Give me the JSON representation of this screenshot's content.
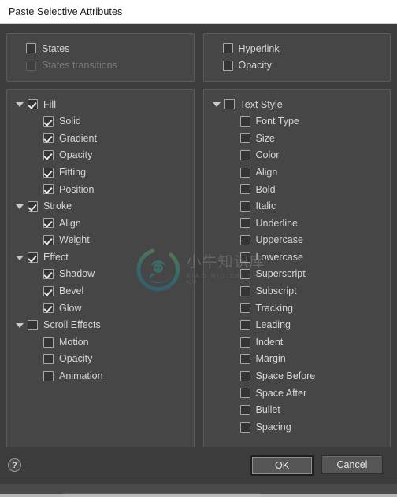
{
  "window": {
    "title": "Paste Selective Attributes"
  },
  "panels": {
    "left_top": {
      "name": "states-panel",
      "items": [
        {
          "label": "States",
          "checked": false,
          "disabled": false,
          "level": "plain"
        },
        {
          "label": "States transitions",
          "checked": false,
          "disabled": true,
          "level": "plain"
        }
      ]
    },
    "right_top": {
      "name": "hyperlink-panel",
      "items": [
        {
          "label": "Hyperlink",
          "checked": false,
          "disabled": false,
          "level": "plain"
        },
        {
          "label": "Opacity",
          "checked": false,
          "disabled": false,
          "level": "plain"
        }
      ]
    },
    "left_main": {
      "name": "graphic-attributes-panel",
      "items": [
        {
          "label": "Fill",
          "checked": true,
          "disabled": false,
          "level": "group",
          "expanded": true
        },
        {
          "label": "Solid",
          "checked": true,
          "disabled": false,
          "level": "child"
        },
        {
          "label": "Gradient",
          "checked": true,
          "disabled": false,
          "level": "child"
        },
        {
          "label": "Opacity",
          "checked": true,
          "disabled": false,
          "level": "child"
        },
        {
          "label": "Fitting",
          "checked": true,
          "disabled": false,
          "level": "child"
        },
        {
          "label": "Position",
          "checked": true,
          "disabled": false,
          "level": "child"
        },
        {
          "label": "Stroke",
          "checked": true,
          "disabled": false,
          "level": "group",
          "expanded": true
        },
        {
          "label": "Align",
          "checked": true,
          "disabled": false,
          "level": "child"
        },
        {
          "label": "Weight",
          "checked": true,
          "disabled": false,
          "level": "child"
        },
        {
          "label": "Effect",
          "checked": true,
          "disabled": false,
          "level": "group",
          "expanded": true
        },
        {
          "label": "Shadow",
          "checked": true,
          "disabled": false,
          "level": "child"
        },
        {
          "label": "Bevel",
          "checked": true,
          "disabled": false,
          "level": "child"
        },
        {
          "label": "Glow",
          "checked": true,
          "disabled": false,
          "level": "child"
        },
        {
          "label": "Scroll Effects",
          "checked": false,
          "disabled": false,
          "level": "group",
          "expanded": true
        },
        {
          "label": "Motion",
          "checked": false,
          "disabled": false,
          "level": "child"
        },
        {
          "label": "Opacity",
          "checked": false,
          "disabled": false,
          "level": "child"
        },
        {
          "label": "Animation",
          "checked": false,
          "disabled": false,
          "level": "child"
        }
      ]
    },
    "right_main": {
      "name": "text-style-panel",
      "items": [
        {
          "label": "Text Style",
          "checked": false,
          "disabled": false,
          "level": "group",
          "expanded": true
        },
        {
          "label": "Font Type",
          "checked": false,
          "disabled": false,
          "level": "child"
        },
        {
          "label": "Size",
          "checked": false,
          "disabled": false,
          "level": "child"
        },
        {
          "label": "Color",
          "checked": false,
          "disabled": false,
          "level": "child"
        },
        {
          "label": "Align",
          "checked": false,
          "disabled": false,
          "level": "child"
        },
        {
          "label": "Bold",
          "checked": false,
          "disabled": false,
          "level": "child"
        },
        {
          "label": "Italic",
          "checked": false,
          "disabled": false,
          "level": "child"
        },
        {
          "label": "Underline",
          "checked": false,
          "disabled": false,
          "level": "child"
        },
        {
          "label": "Uppercase",
          "checked": false,
          "disabled": false,
          "level": "child"
        },
        {
          "label": "Lowercase",
          "checked": false,
          "disabled": false,
          "level": "child"
        },
        {
          "label": "Superscript",
          "checked": false,
          "disabled": false,
          "level": "child"
        },
        {
          "label": "Subscript",
          "checked": false,
          "disabled": false,
          "level": "child"
        },
        {
          "label": "Tracking",
          "checked": false,
          "disabled": false,
          "level": "child"
        },
        {
          "label": "Leading",
          "checked": false,
          "disabled": false,
          "level": "child"
        },
        {
          "label": "Indent",
          "checked": false,
          "disabled": false,
          "level": "child"
        },
        {
          "label": "Margin",
          "checked": false,
          "disabled": false,
          "level": "child"
        },
        {
          "label": "Space Before",
          "checked": false,
          "disabled": false,
          "level": "child"
        },
        {
          "label": "Space After",
          "checked": false,
          "disabled": false,
          "level": "child"
        },
        {
          "label": "Bullet",
          "checked": false,
          "disabled": false,
          "level": "child"
        },
        {
          "label": "Spacing",
          "checked": false,
          "disabled": false,
          "level": "child"
        }
      ]
    }
  },
  "footer": {
    "help_glyph": "?",
    "ok_label": "OK",
    "cancel_label": "Cancel"
  },
  "watermark": {
    "cn": "小牛知识库",
    "en": "XIAO NIU ZHI SHI KU"
  },
  "colors": {
    "dialog_bg": "#3c3c3c",
    "panel_bg": "#464646",
    "panel_border": "#5b5b5b",
    "label": "#d6d6d6",
    "label_disabled": "#7a7a7a",
    "titlebar_bg": "#ffffff",
    "titlebar_text": "#1a1a1a"
  }
}
